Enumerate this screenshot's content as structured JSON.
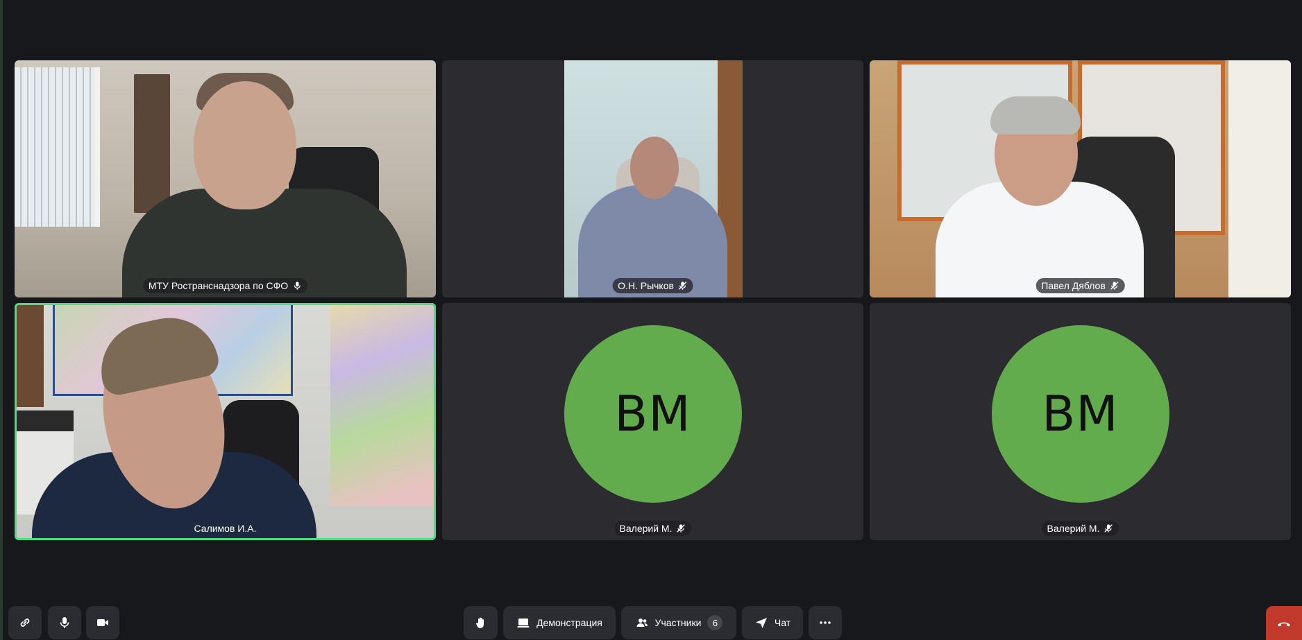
{
  "participants": [
    {
      "name": "МТУ Ространснадзора по СФО",
      "mic": "on",
      "video": true
    },
    {
      "name": "О.Н. Рычков",
      "mic": "muted",
      "video": true
    },
    {
      "name": "Павел Дяблов",
      "mic": "muted",
      "video": true
    },
    {
      "name": "Салимов И.А.",
      "mic": "none",
      "video": true,
      "speaking": true
    },
    {
      "name": "Валерий М.",
      "mic": "muted",
      "video": false,
      "initials": "ВМ",
      "avatar_color": "#63ac4d"
    },
    {
      "name": "Валерий М.",
      "mic": "muted",
      "video": false,
      "initials": "ВМ",
      "avatar_color": "#63ac4d"
    }
  ],
  "toolbar": {
    "raise_hand_icon": "hand-icon",
    "screen_share_label": "Демонстрация",
    "participants_label": "Участники",
    "participants_count": "6",
    "chat_label": "Чат",
    "link_icon": "link-icon",
    "mic_icon": "microphone-icon",
    "camera_icon": "camera-icon",
    "more_icon": "more-icon",
    "end_call_icon": "phone-hangup-icon"
  },
  "colors": {
    "background": "#17181b",
    "tile": "#2b2b30",
    "speaking_border": "#4ade80",
    "end_call": "#c0392b"
  }
}
